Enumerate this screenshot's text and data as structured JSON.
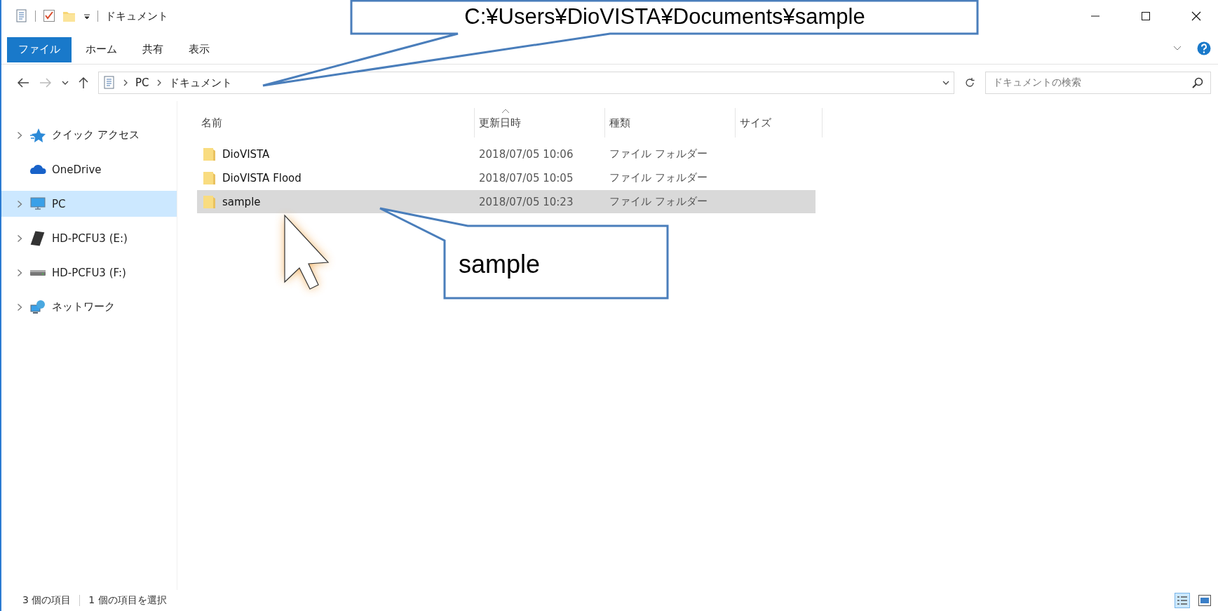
{
  "window": {
    "title": "ドキュメント"
  },
  "ribbon_tabs": [
    {
      "label": "ファイル",
      "selected": true
    },
    {
      "label": "ホーム",
      "selected": false
    },
    {
      "label": "共有",
      "selected": false
    },
    {
      "label": "表示",
      "selected": false
    }
  ],
  "address_bar": {
    "path": [
      "PC",
      "ドキュメント"
    ]
  },
  "search": {
    "placeholder": "ドキュメントの検索"
  },
  "sidebar": {
    "items": [
      {
        "label": "クイック アクセス",
        "expandable": true,
        "selected": false
      },
      {
        "label": "OneDrive",
        "expandable": false,
        "selected": false
      },
      {
        "label": "PC",
        "expandable": true,
        "selected": true
      },
      {
        "label": "HD-PCFU3 (E:)",
        "expandable": true,
        "selected": false
      },
      {
        "label": "HD-PCFU3 (F:)",
        "expandable": true,
        "selected": false
      },
      {
        "label": "ネットワーク",
        "expandable": true,
        "selected": false
      }
    ]
  },
  "table": {
    "columns": [
      "名前",
      "更新日時",
      "種類",
      "サイズ"
    ],
    "rows": [
      {
        "name": "DioVISTA",
        "modified": "2018/07/05 10:06",
        "type": "ファイル フォルダー",
        "selected": false
      },
      {
        "name": "DioVISTA Flood",
        "modified": "2018/07/05 10:05",
        "type": "ファイル フォルダー",
        "selected": false
      },
      {
        "name": "sample",
        "modified": "2018/07/05 10:23",
        "type": "ファイル フォルダー",
        "selected": true
      }
    ]
  },
  "status_bar": {
    "item_count": "3 個の項目",
    "selection": "1 個の項目を選択"
  },
  "callouts": [
    {
      "text": "C:¥Users¥DioVISTA¥Documents¥sample"
    },
    {
      "text": "sample"
    }
  ]
}
